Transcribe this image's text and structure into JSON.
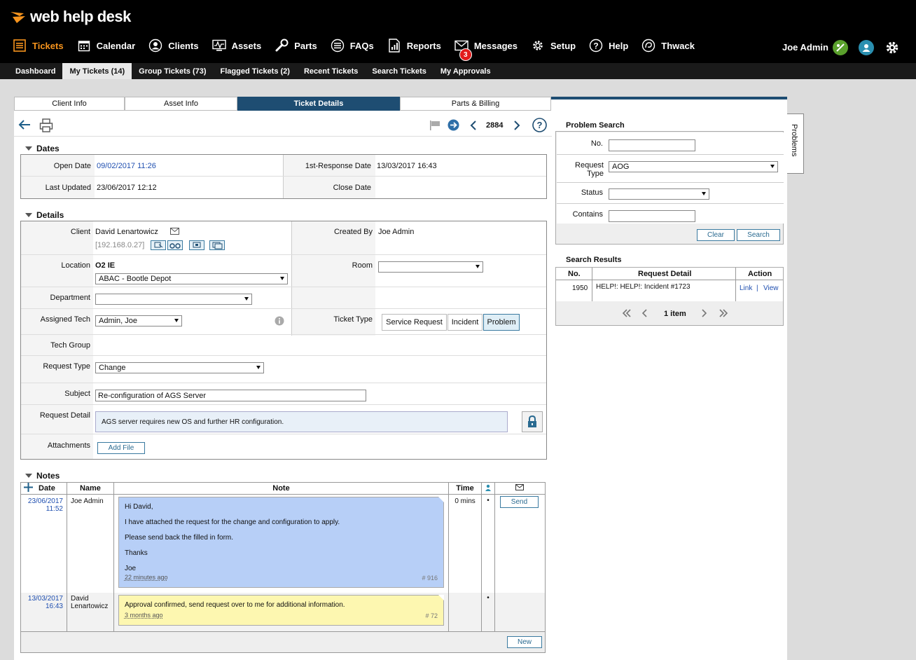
{
  "app": {
    "brand": "web help desk",
    "user": "Joe Admin"
  },
  "nav": [
    {
      "label": "Tickets",
      "icon": "tickets-icon",
      "active": true
    },
    {
      "label": "Calendar",
      "icon": "calendar-icon"
    },
    {
      "label": "Clients",
      "icon": "clients-icon"
    },
    {
      "label": "Assets",
      "icon": "assets-icon"
    },
    {
      "label": "Parts",
      "icon": "parts-icon"
    },
    {
      "label": "FAQs",
      "icon": "faqs-icon"
    },
    {
      "label": "Reports",
      "icon": "reports-icon"
    },
    {
      "label": "Messages",
      "icon": "messages-icon",
      "badge": "3"
    },
    {
      "label": "Setup",
      "icon": "setup-icon"
    },
    {
      "label": "Help",
      "icon": "help-icon"
    },
    {
      "label": "Thwack",
      "icon": "thwack-icon"
    }
  ],
  "subnav": [
    {
      "label": "Dashboard"
    },
    {
      "label": "My Tickets (14)",
      "active": true
    },
    {
      "label": "Group Tickets (73)"
    },
    {
      "label": "Flagged Tickets (2)"
    },
    {
      "label": "Recent Tickets"
    },
    {
      "label": "Search Tickets"
    },
    {
      "label": "My Approvals"
    }
  ],
  "tabs": [
    {
      "label": "Client Info"
    },
    {
      "label": "Asset Info"
    },
    {
      "label": "Ticket Details",
      "active": true
    },
    {
      "label": "Parts & Billing"
    }
  ],
  "toolbar": {
    "ticket_number": "2884"
  },
  "dates": {
    "title": "Dates",
    "open_label": "Open Date",
    "open_value": "09/02/2017 11:26",
    "first_response_label": "1st-Response Date",
    "first_response_value": "13/03/2017 16:43",
    "updated_label": "Last Updated",
    "updated_value": "23/06/2017 12:12",
    "close_label": "Close Date",
    "close_value": ""
  },
  "details": {
    "title": "Details",
    "client_label": "Client",
    "client_name": "David Lenartowicz",
    "client_ip": "[192.168.0.27]",
    "created_by_label": "Created By",
    "created_by": "Joe Admin",
    "location_label": "Location",
    "location_value": "O2 IE",
    "location_select": "ABAC - Bootle Depot",
    "room_label": "Room",
    "room_value": "",
    "department_label": "Department",
    "department_value": "",
    "tech_label": "Assigned Tech",
    "tech_value": "Admin, Joe",
    "ticket_type_label": "Ticket Type",
    "ticket_types": [
      "Service Request",
      "Incident",
      "Problem"
    ],
    "ticket_type_selected": "Problem",
    "tech_group_label": "Tech Group",
    "request_type_label": "Request Type",
    "request_type_value": "Change",
    "subject_label": "Subject",
    "subject_value": "Re-configuration of AGS Server",
    "request_detail_label": "Request Detail",
    "request_detail_value": "AGS server requires new OS and further HR configuration.",
    "attachments_label": "Attachments",
    "add_file_label": "Add File"
  },
  "notes": {
    "title": "Notes",
    "headers": {
      "date": "Date",
      "name": "Name",
      "note": "Note",
      "time": "Time"
    },
    "entries": [
      {
        "date": "23/06/2017",
        "time_of_day": "11:52",
        "name": "Joe Admin",
        "lines": [
          "Hi David,",
          "I have attached the request for the change and configuration to apply.",
          "Please send back the filled in form.",
          "Thanks",
          "Joe"
        ],
        "ago": "22 minutes ago",
        "num": "# 916",
        "time": "0 mins",
        "bullet": "•",
        "send": "Send"
      },
      {
        "date": "13/03/2017",
        "time_of_day": "16:43",
        "name": "David Lenartowicz",
        "lines": [
          "Approval confirmed, send request over to me for additional information."
        ],
        "ago": "3 months ago",
        "num": "# 72",
        "time": "",
        "bullet": "•"
      }
    ],
    "new_label": "New"
  },
  "problem_search": {
    "title": "Problem Search",
    "no_label": "No.",
    "no_value": "",
    "request_type_label": "Request Type",
    "request_type_value": "AOG",
    "status_label": "Status",
    "status_value": "",
    "contains_label": "Contains",
    "contains_value": "",
    "clear_label": "Clear",
    "search_label": "Search"
  },
  "search_results": {
    "title": "Search Results",
    "headers": [
      "No.",
      "Request Detail",
      "Action"
    ],
    "rows": [
      {
        "no": "1950",
        "detail": "HELP!: HELP!: Incident #1723",
        "link": "Link",
        "sep": "|",
        "view": "View"
      }
    ],
    "count": "1 item"
  },
  "side_tab": {
    "label": "Problems"
  },
  "colors": {
    "accent": "#f7941d",
    "tab_active": "#1e4d72",
    "link": "#1f4fb0",
    "note_blue": "#b7cff7",
    "note_yellow": "#fdf7b0",
    "badge": "#e21b1b"
  }
}
